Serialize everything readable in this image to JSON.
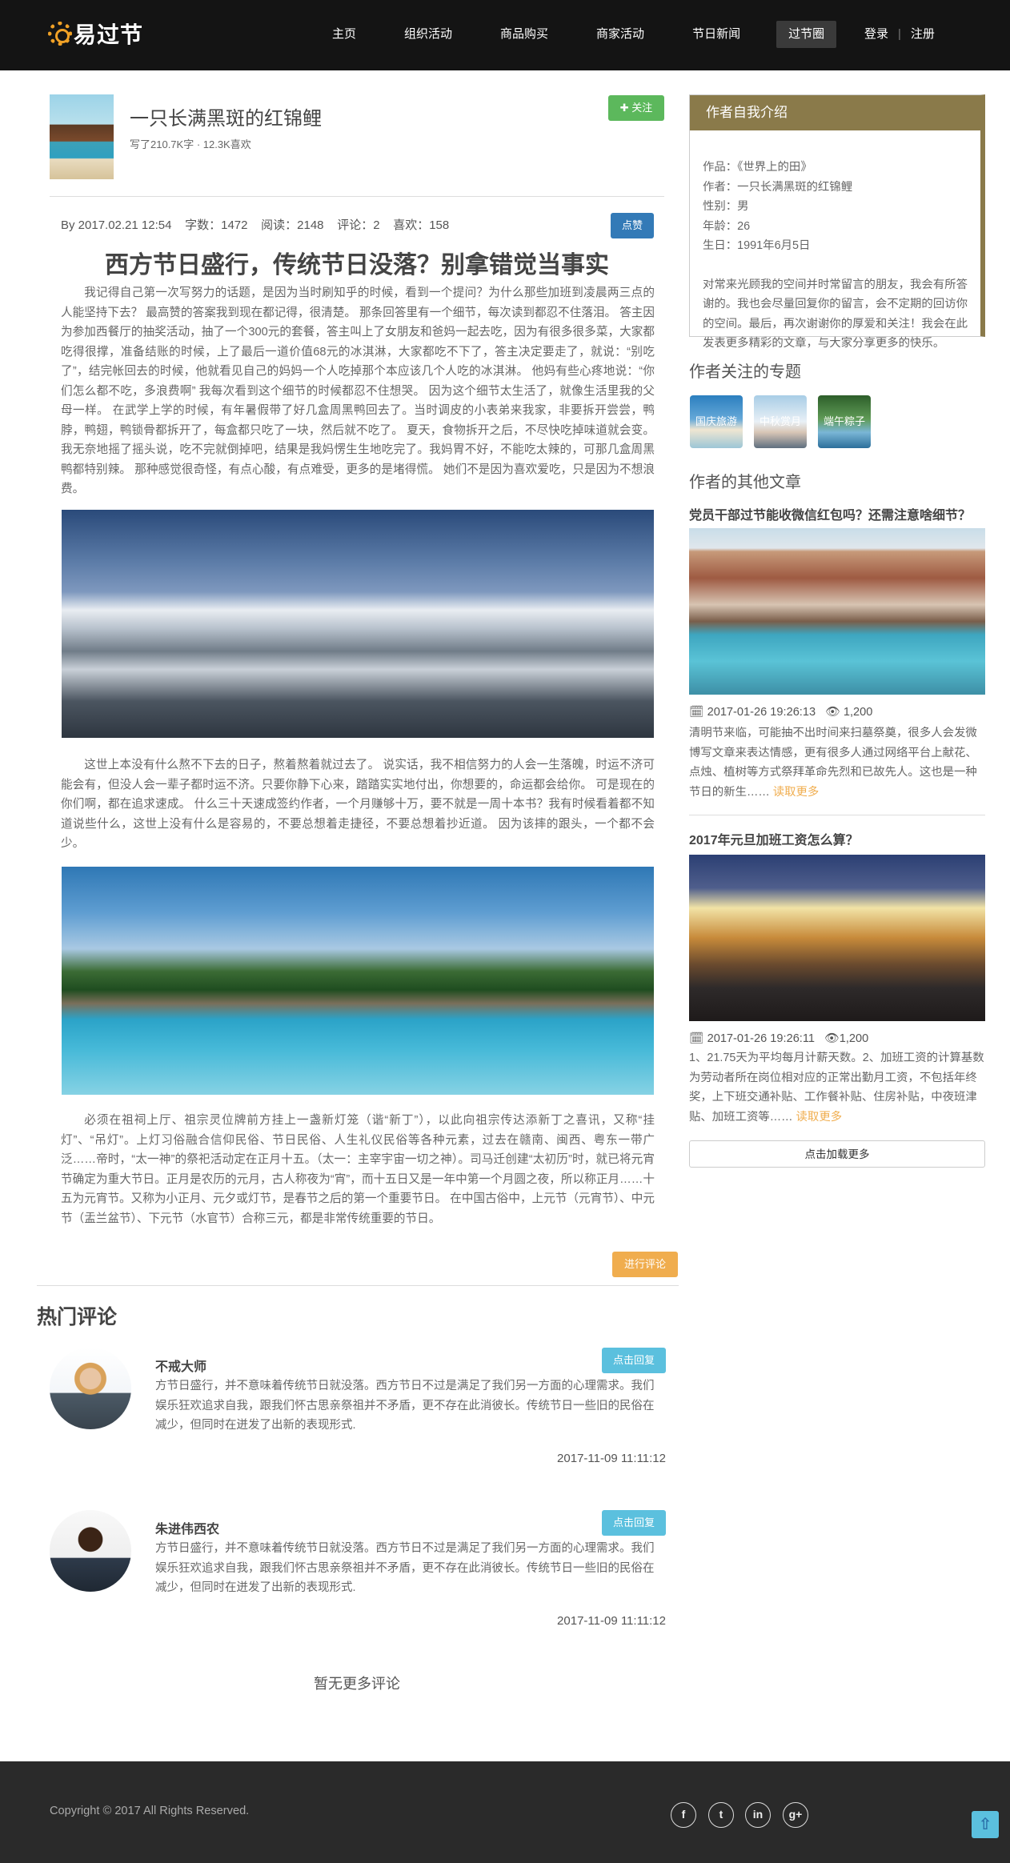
{
  "header": {
    "logo_text": "易过节",
    "nav": [
      "主页",
      "组织活动",
      "商品购买",
      "商家活动",
      "节日新闻",
      "过节圈"
    ],
    "active_nav": "过节圈",
    "login": "登录",
    "register": "注册"
  },
  "author": {
    "name": "一只长满黑斑的红锦鲤",
    "stats": "写了210.7K字 · 12.3K喜欢",
    "follow_label": "✚ 关注"
  },
  "article": {
    "meta": "By 2017.02.21 12:54    字数：1472    阅读：2148    评论：2    喜欢：158",
    "like_label": "点赞",
    "title": "西方节日盛行，传统节日没落？别拿错觉当事实",
    "para1": "我记得自己第一次写努力的话题，是因为当时刷知乎的时候，看到一个提问？为什么那些加班到凌晨两三点的人能坚持下去？ 最高赞的答案我到现在都记得，很清楚。 那条回答里有一个细节，每次读到都忍不住落泪。 答主因为参加西餐厅的抽奖活动，抽了一个300元的套餐，答主叫上了女朋友和爸妈一起去吃，因为有很多很多菜，大家都吃得很撑，准备结账的时候，上了最后一道价值68元的冰淇淋，大家都吃不下了，答主决定要走了，就说：“别吃了”，结完帐回去的时候，他就看见自己的妈妈一个人吃掉那个本应该几个人吃的冰淇淋。 他妈有些心疼地说：“你们怎么都不吃，多浪费啊” 我每次看到这个细节的时候都忍不住想哭。 因为这个细节太生活了，就像生活里我的父母一样。 在武学上学的时候，有年暑假带了好几盒周黑鸭回去了。当时调皮的小表弟来我家，非要拆开尝尝，鸭脖，鸭翅，鸭锁骨都拆开了，每盒都只吃了一块，然后就不吃了。 夏天，食物拆开之后，不尽快吃掉味道就会变。我无奈地摇了摇头说，吃不完就倒掉吧，结果是我妈愣生生地吃完了。我妈胃不好，不能吃太辣的，可那几盒周黑鸭都特别辣。 那种感觉很奇怪，有点心酸，有点难受，更多的是堵得慌。 她们不是因为喜欢爱吃，只是因为不想浪费。",
    "para2": "这世上本没有什么熬不下去的日子，熬着熬着就过去了。 说实话，我不相信努力的人会一生落魄，时运不济可能会有，但没人会一辈子都时运不济。只要你静下心来，踏踏实实地付出，你想要的，命运都会给你。 可是现在的你们啊，都在追求速成。 什么三十天速成签约作者，一个月赚够十万，要不就是一周十本书？我有时候看着都不知道说些什么，这世上没有什么是容易的，不要总想着走捷径，不要总想着抄近道。 因为该摔的跟头，一个都不会少。",
    "para3": "必须在祖祠上厅、祖宗灵位牌前方挂上一盏新灯笼（谐“新丁”），以此向祖宗传达添新丁之喜讯，又称“挂灯”、“吊灯”。上灯习俗融合信仰民俗、节日民俗、人生礼仪民俗等各种元素，过去在赣南、闽西、粤东一带广泛……帝时，“太一神”的祭祀活动定在正月十五。（太一：主宰宇宙一切之神）。司马迁创建“太初历”时，就已将元宵节确定为重大节日。正月是农历的元月，古人称夜为“宵”，而十五日又是一年中第一个月圆之夜，所以称正月……十五为元宵节。又称为小正月、元夕或灯节，是春节之后的第一个重要节日。 在中国古俗中，上元节（元宵节）、中元节（盂兰盆节）、下元节（水官节）合称三元，都是非常传统重要的节日。",
    "comment_label": "进行评论"
  },
  "comments": {
    "section_title": "热门评论",
    "items": [
      {
        "name": "不戒大师",
        "reply_label": "点击回复",
        "text": "方节日盛行，并不意味着传统节日就没落。西方节日不过是满足了我们另一方面的心理需求。我们娱乐狂欢追求自我，跟我们怀古思亲祭祖并不矛盾，更不存在此消彼长。传统节日一些旧的民俗在减少，但同时在迸发了出新的表现形式.",
        "time": "2017-11-09 11:11:12"
      },
      {
        "name": "朱进伟西农",
        "reply_label": "点击回复",
        "text": "方节日盛行，并不意味着传统节日就没落。西方节日不过是满足了我们另一方面的心理需求。我们娱乐狂欢追求自我，跟我们怀古思亲祭祖并不矛盾，更不存在此消彼长。传统节日一些旧的民俗在减少，但同时在迸发了出新的表现形式.",
        "time": "2017-11-09 11:11:12"
      }
    ],
    "no_more": "暂无更多评论"
  },
  "sidebar": {
    "intro_title": "作者自我介绍",
    "intro_lines": [
      "作品：《世界上的田》",
      "作者：一只长满黑斑的红锦鲤",
      "性别：男",
      "年龄：26",
      "生日：1991年6月5日"
    ],
    "intro_text": "对常来光顾我的空间并时常留言的朋友，我会有所答谢的。我也会尽量回复你的留言，会不定期的回访你的空间。最后，再次谢谢你的厚爱和关注！我会在此发表更多精彩的文章，与大家分享更多的快乐。",
    "topics_title": "作者关注的专题",
    "topics": [
      "国庆旅游",
      "中秋赏月",
      "端午粽子"
    ],
    "others_title": "作者的其他文章",
    "articles": [
      {
        "title": "党员干部过节能收微信红包吗？还需注意啥细节？",
        "meta": "🗓 2017-01-26 19:26:13   👁 1,200",
        "text": "清明节来临，可能抽不出时间来扫墓祭奠，很多人会发微博写文章来表达情感，更有很多人通过网络平台上献花、点烛、植树等方式祭拜革命先烈和已故先人。这也是一种节日的新生……",
        "read_more": "读取更多"
      },
      {
        "title": "2017年元旦加班工资怎么算？",
        "meta": "🗓 2017-01-26 19:26:11   👁1,200",
        "text": "1、21.75天为平均每月计薪天数。2、加班工资的计算基数为劳动者所在岗位相对应的正常出勤月工资，不包括年终奖，上下班交通补贴、工作餐补贴、住房补贴，中夜班津贴、加班工资等……",
        "read_more": "读取更多"
      }
    ],
    "load_more": "点击加载更多"
  },
  "footer": {
    "copyright": "Copyright © 2017 All Rights Reserved.",
    "social": [
      "f",
      "t",
      "in",
      "g+"
    ],
    "back_top": "⇧"
  }
}
